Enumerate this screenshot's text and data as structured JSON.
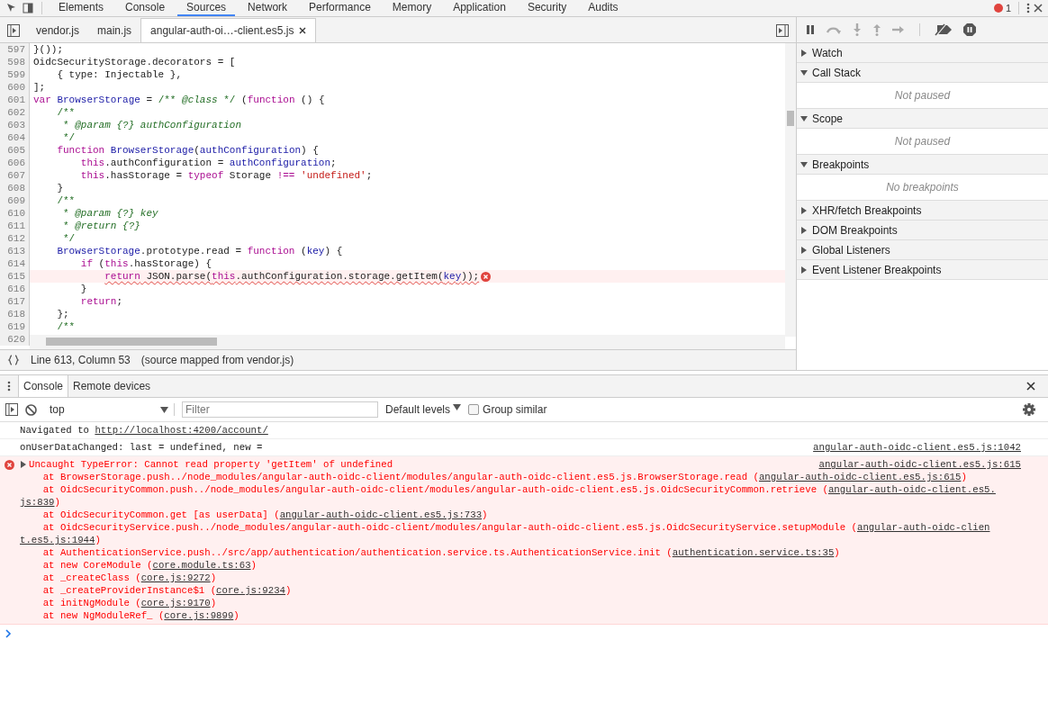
{
  "main_tabs": [
    {
      "label": "Elements",
      "selected": false
    },
    {
      "label": "Console",
      "selected": false
    },
    {
      "label": "Sources",
      "selected": true
    },
    {
      "label": "Network",
      "selected": false
    },
    {
      "label": "Performance",
      "selected": false
    },
    {
      "label": "Memory",
      "selected": false
    },
    {
      "label": "Application",
      "selected": false
    },
    {
      "label": "Security",
      "selected": false
    },
    {
      "label": "Audits",
      "selected": false
    }
  ],
  "error_count": "1",
  "editor_tabs": [
    {
      "label": "vendor.js",
      "selected": false,
      "closable": false
    },
    {
      "label": "main.js",
      "selected": false,
      "closable": false
    },
    {
      "label": "angular-auth-oi…-client.es5.js",
      "selected": true,
      "closable": true
    }
  ],
  "code_lines": [
    {
      "num": "597",
      "tokens": [
        {
          "kind": "p",
          "text": "}());"
        }
      ]
    },
    {
      "num": "598",
      "tokens": [
        {
          "kind": "p",
          "text": "OidcSecurityStorage.decorators = ["
        }
      ]
    },
    {
      "num": "599",
      "tokens": [
        {
          "kind": "p",
          "text": "    { type: Injectable },"
        }
      ]
    },
    {
      "num": "600",
      "tokens": [
        {
          "kind": "p",
          "text": "];"
        }
      ]
    },
    {
      "num": "601",
      "tokens": [
        {
          "kind": "k",
          "text": "var"
        },
        {
          "kind": "n",
          "text": " BrowserStorage"
        },
        {
          "kind": "p",
          "text": " = "
        },
        {
          "kind": "c",
          "text": "/** "
        },
        {
          "kind": "doc",
          "text": "@class"
        },
        {
          "kind": "c",
          "text": " */"
        },
        {
          "kind": "p",
          "text": " ("
        },
        {
          "kind": "k",
          "text": "function"
        },
        {
          "kind": "p",
          "text": " () {"
        }
      ]
    },
    {
      "num": "602",
      "tokens": [
        {
          "kind": "c",
          "text": "    /**"
        }
      ]
    },
    {
      "num": "603",
      "tokens": [
        {
          "kind": "c",
          "text": "     * "
        },
        {
          "kind": "doc",
          "text": "@param {?} authConfiguration"
        }
      ]
    },
    {
      "num": "604",
      "tokens": [
        {
          "kind": "c",
          "text": "     */"
        }
      ]
    },
    {
      "num": "605",
      "tokens": [
        {
          "kind": "k",
          "text": "    function"
        },
        {
          "kind": "n",
          "text": " BrowserStorage"
        },
        {
          "kind": "p",
          "text": "("
        },
        {
          "kind": "n",
          "text": "authConfiguration"
        },
        {
          "kind": "p",
          "text": ") {"
        }
      ]
    },
    {
      "num": "606",
      "tokens": [
        {
          "kind": "k",
          "text": "        this"
        },
        {
          "kind": "p",
          "text": ".authConfiguration = "
        },
        {
          "kind": "n",
          "text": "authConfiguration"
        },
        {
          "kind": "p",
          "text": ";"
        }
      ]
    },
    {
      "num": "607",
      "tokens": [
        {
          "kind": "k",
          "text": "        this"
        },
        {
          "kind": "p",
          "text": ".hasStorage = "
        },
        {
          "kind": "k",
          "text": "typeof"
        },
        {
          "kind": "p",
          "text": " Storage "
        },
        {
          "kind": "k",
          "text": "!=="
        },
        {
          "kind": "s",
          "text": " 'undefined'"
        },
        {
          "kind": "p",
          "text": ";"
        }
      ]
    },
    {
      "num": "608",
      "tokens": [
        {
          "kind": "p",
          "text": "    }"
        }
      ]
    },
    {
      "num": "609",
      "tokens": [
        {
          "kind": "c",
          "text": "    /**"
        }
      ]
    },
    {
      "num": "610",
      "tokens": [
        {
          "kind": "c",
          "text": "     * "
        },
        {
          "kind": "doc",
          "text": "@param {?} key"
        }
      ]
    },
    {
      "num": "611",
      "tokens": [
        {
          "kind": "c",
          "text": "     * "
        },
        {
          "kind": "doc",
          "text": "@return {?}"
        }
      ]
    },
    {
      "num": "612",
      "tokens": [
        {
          "kind": "c",
          "text": "     */"
        }
      ]
    },
    {
      "num": "613",
      "tokens": [
        {
          "kind": "n",
          "text": "    BrowserStorage"
        },
        {
          "kind": "p",
          "text": ".prototype.read = "
        },
        {
          "kind": "k",
          "text": "function"
        },
        {
          "kind": "p",
          "text": " ("
        },
        {
          "kind": "n",
          "text": "key"
        },
        {
          "kind": "p",
          "text": ") {"
        }
      ]
    },
    {
      "num": "614",
      "tokens": [
        {
          "kind": "k",
          "text": "        if"
        },
        {
          "kind": "p",
          "text": " ("
        },
        {
          "kind": "k",
          "text": "this"
        },
        {
          "kind": "p",
          "text": ".hasStorage) {"
        }
      ]
    },
    {
      "num": "615",
      "error": true,
      "tokens": [
        {
          "kind": "k",
          "text": "            return"
        },
        {
          "kind": "p",
          "text": " JSON.parse("
        },
        {
          "kind": "k",
          "text": "this"
        },
        {
          "kind": "p",
          "text": ".authConfiguration.storage.getItem("
        },
        {
          "kind": "n",
          "text": "key"
        },
        {
          "kind": "p",
          "text": "));"
        }
      ]
    },
    {
      "num": "616",
      "tokens": [
        {
          "kind": "p",
          "text": "        }"
        }
      ]
    },
    {
      "num": "617",
      "tokens": [
        {
          "kind": "k",
          "text": "        return"
        },
        {
          "kind": "p",
          "text": ";"
        }
      ]
    },
    {
      "num": "618",
      "tokens": [
        {
          "kind": "p",
          "text": "    };"
        }
      ]
    },
    {
      "num": "619",
      "tokens": [
        {
          "kind": "c",
          "text": "    /**"
        }
      ]
    },
    {
      "num": "620"
    }
  ],
  "status": {
    "position": "Line 613, Column 53",
    "source_map": "(source mapped from vendor.js)"
  },
  "debug_sections": [
    {
      "title": "Watch",
      "expanded": false
    },
    {
      "title": "Call Stack",
      "expanded": true,
      "empty_text": "Not paused"
    },
    {
      "title": "Scope",
      "expanded": true,
      "empty_text": "Not paused"
    },
    {
      "title": "Breakpoints",
      "expanded": true,
      "empty_text": "No breakpoints"
    },
    {
      "title": "XHR/fetch Breakpoints",
      "expanded": false
    },
    {
      "title": "DOM Breakpoints",
      "expanded": false
    },
    {
      "title": "Global Listeners",
      "expanded": false
    },
    {
      "title": "Event Listener Breakpoints",
      "expanded": false
    }
  ],
  "drawer_tabs": [
    {
      "label": "Console",
      "selected": true
    },
    {
      "label": "Remote devices",
      "selected": false
    }
  ],
  "console_toolbar": {
    "context": "top",
    "filter_placeholder": "Filter",
    "levels": "Default levels",
    "group_similar": {
      "label": "Group similar",
      "checked": false
    }
  },
  "messages": [
    {
      "kind": "navigation",
      "text": "Navigated to",
      "link": "http://localhost:4200/account/"
    },
    {
      "kind": "log",
      "text": "onUserDataChanged: last = undefined, new =",
      "source": "angular-auth-oidc-client.es5.js:1042"
    },
    {
      "kind": "error",
      "text": "Uncaught TypeError: Cannot read property 'getItem' of undefined",
      "source": "angular-auth-oidc-client.es5.js:615",
      "stack": [
        {
          "text": "    at BrowserStorage.push../node_modules/angular-auth-oidc-client/modules/angular-auth-oidc-client.es5.js.BrowserStorage.read (",
          "link": "angular-auth-oidc-client.es5.js:615",
          "after": ")"
        },
        {
          "text": "    at OidcSecurityCommon.push../node_modules/angular-auth-oidc-client/modules/angular-auth-oidc-client.es5.js.OidcSecurityCommon.retrieve (",
          "link": "angular-auth-oidc-client.es5."
        },
        {
          "link": "js:839",
          "after": ")"
        },
        {
          "text": "    at OidcSecurityCommon.get [as userData] (",
          "link": "angular-auth-oidc-client.es5.js:733",
          "after": ")"
        },
        {
          "text": "    at OidcSecurityService.push../node_modules/angular-auth-oidc-client/modules/angular-auth-oidc-client.es5.js.OidcSecurityService.setupModule (",
          "link": "angular-auth-oidc-clien"
        },
        {
          "link": "t.es5.js:1944",
          "after": ")"
        },
        {
          "text": "    at AuthenticationService.push../src/app/authentication/authentication.service.ts.AuthenticationService.init (",
          "link": "authentication.service.ts:35",
          "after": ")"
        },
        {
          "text": "    at new CoreModule (",
          "link": "core.module.ts:63",
          "after": ")"
        },
        {
          "text": "    at _createClass (",
          "link": "core.js:9272",
          "after": ")"
        },
        {
          "text": "    at _createProviderInstance$1 (",
          "link": "core.js:9234",
          "after": ")"
        },
        {
          "text": "    at initNgModule (",
          "link": "core.js:9170",
          "after": ")"
        },
        {
          "text": "    at new NgModuleRef_ (",
          "link": "core.js:9899",
          "after": ")"
        }
      ]
    }
  ]
}
